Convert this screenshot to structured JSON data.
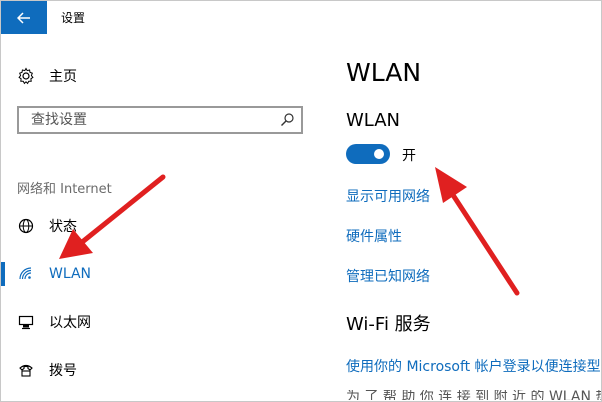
{
  "window": {
    "title": "设置"
  },
  "sidebar": {
    "home_label": "主页",
    "search": {
      "value": "",
      "placeholder": "查找设置"
    },
    "section_title": "网络和 Internet",
    "items": [
      {
        "label": "状态",
        "icon": "globe-icon",
        "active": false
      },
      {
        "label": "WLAN",
        "icon": "wifi-icon",
        "active": true
      },
      {
        "label": "以太网",
        "icon": "ethernet-icon",
        "active": false
      },
      {
        "label": "拨号",
        "icon": "dialup-icon",
        "active": false
      }
    ]
  },
  "main": {
    "page_title": "WLAN",
    "wlan_section_title": "WLAN",
    "toggle": {
      "state": "on",
      "label": "开"
    },
    "links": [
      "显示可用网络",
      "硬件属性",
      "管理已知网络"
    ],
    "wifi_services_title": "Wi-Fi 服务",
    "wifi_services_link": "使用你的 Microsoft 帐户登录以便连接型"
  },
  "colors": {
    "accent": "#0f6cbd",
    "annotation_arrow": "#e02020"
  }
}
